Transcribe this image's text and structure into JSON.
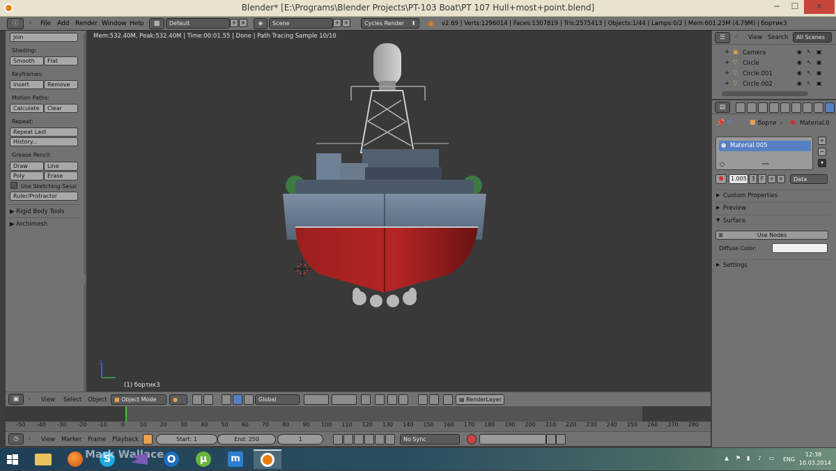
{
  "window": {
    "title": "Blender* [E:\\Programs\\Blender Projects\\PT-103 Boat\\PT 107 Hull+most+point.blend]",
    "min_glyph": "─",
    "max_glyph": "☐",
    "close_glyph": "✕"
  },
  "info_header": {
    "menus": [
      "File",
      "Add",
      "Render",
      "Window",
      "Help"
    ],
    "screen_layout": "Default",
    "scene": "Scene",
    "render_engine": "Cycles Render",
    "stats": "v2.69 | Verts:1296014 | Faces:1307819 | Tris:2575413 | Objects:1/44 | Lamps:0/2 | Mem:601.23M (4.79M) | бортик3"
  },
  "toolshelf": {
    "join": "Join",
    "shading_label": "Shading:",
    "smooth": "Smooth",
    "flat": "Flat",
    "keyframes_label": "Keyframes:",
    "insert": "Insert",
    "remove": "Remove",
    "motion_paths_label": "Motion Paths:",
    "calculate": "Calculate",
    "clear": "Clear",
    "repeat_label": "Repeat:",
    "repeat_last": "Repeat Last",
    "history": "History...",
    "grease_pencil_label": "Grease Pencil:",
    "draw": "Draw",
    "line": "Line",
    "poly": "Poly",
    "erase": "Erase",
    "use_sketching": "Use Sketching Sessi",
    "ruler": "Ruler/Protractor",
    "rigid_body": "Rigid Body Tools",
    "archimesh": "Archimesh"
  },
  "viewport": {
    "render_status": "Mem:532.40M, Peak:532.40M | Time:00:01.55 | Done | Path Tracing Sample 10/10",
    "object_label": "(1) бортик3",
    "colors": {
      "hull_top": "#6e7f94",
      "hull_bottom": "#8d1a1a"
    }
  },
  "viewport_toolbar": {
    "menus": [
      "View",
      "Select",
      "Object"
    ],
    "mode": "Object Mode",
    "orientation": "Global",
    "render_layer": "RenderLayer"
  },
  "timeline": {
    "ticks": [
      "-50",
      "-40",
      "-30",
      "-20",
      "-10",
      "0",
      "10",
      "20",
      "30",
      "40",
      "50",
      "60",
      "70",
      "80",
      "90",
      "100",
      "110",
      "120",
      "130",
      "140",
      "150",
      "160",
      "170",
      "180",
      "190",
      "200",
      "210",
      "220",
      "230",
      "240",
      "250",
      "260",
      "270",
      "280"
    ],
    "current_frame": 1,
    "menus": [
      "View",
      "Marker",
      "Frame",
      "Playback"
    ],
    "start": "Start: 1",
    "end": "End: 250",
    "frame": "1",
    "sync": "No Sync"
  },
  "outliner": {
    "menus": [
      "View",
      "Search"
    ],
    "scope": "All Scenes",
    "items": [
      "Camera",
      "Circle",
      "Circle.001",
      "Circle.002"
    ]
  },
  "properties": {
    "object_path": "борти",
    "material_path": "Material.0",
    "material_slot": "Material.005",
    "pass_index": "1.005",
    "users": "3",
    "fake_user": "F",
    "link": "Data",
    "sections": {
      "custom_props": "Custom Properties",
      "preview": "Preview",
      "surface": "Surface",
      "settings": "Settings"
    },
    "use_nodes": "Use Nodes",
    "diffuse_label": "Diffuse Color:"
  },
  "taskbar": {
    "watermark": "Mark Wallace",
    "lang": "ENG",
    "time": "12:38",
    "date": "10.03.2014"
  }
}
